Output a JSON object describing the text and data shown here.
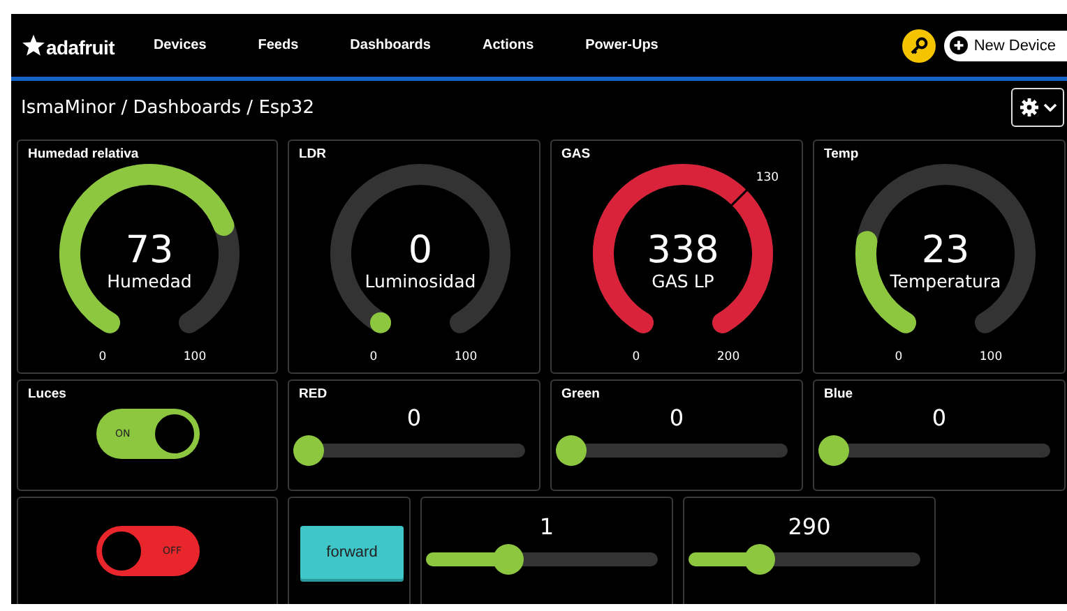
{
  "header": {
    "logo": "adafruit",
    "nav": [
      {
        "label": "Devices"
      },
      {
        "label": "Feeds"
      },
      {
        "label": "Dashboards"
      },
      {
        "label": "Actions"
      },
      {
        "label": "Power-Ups"
      }
    ],
    "new_device_button": "New Device"
  },
  "breadcrumb": "IsmaMinor / Dashboards / Esp32",
  "rows": [
    [
      {
        "kind": "gauge",
        "title": "Humedad relativa",
        "value": "73",
        "label": "Humedad",
        "min": "0",
        "max": "100",
        "color": "#8dc63f"
      },
      {
        "kind": "gauge",
        "title": "LDR",
        "value": "0",
        "label": "Luminosidad",
        "min": "0",
        "max": "100",
        "color": "#8dc63f"
      },
      {
        "kind": "gauge",
        "title": "GAS",
        "value": "338",
        "label": "GAS LP",
        "min": "0",
        "max": "200",
        "threshold": "130",
        "color": "#d9233a"
      },
      {
        "kind": "gauge",
        "title": "Temp",
        "value": "23",
        "label": "Temperatura",
        "min": "0",
        "max": "100",
        "color": "#8dc63f"
      }
    ],
    [
      {
        "kind": "toggle",
        "title": "Luces",
        "on": true,
        "text": "ON"
      },
      {
        "kind": "slider",
        "title": "RED",
        "value": "0",
        "level": 0
      },
      {
        "kind": "slider",
        "title": "Green",
        "value": "0",
        "level": 0
      },
      {
        "kind": "slider",
        "title": "Blue",
        "value": "0",
        "level": 0
      }
    ],
    [
      {
        "kind": "toggle",
        "on": false,
        "text": "OFF"
      },
      {
        "kind": "button",
        "label": "forward"
      },
      {
        "kind": "slider",
        "value": "1",
        "level": 0.33
      },
      {
        "kind": "slider",
        "value": "290",
        "level": 0.28
      }
    ]
  ]
}
